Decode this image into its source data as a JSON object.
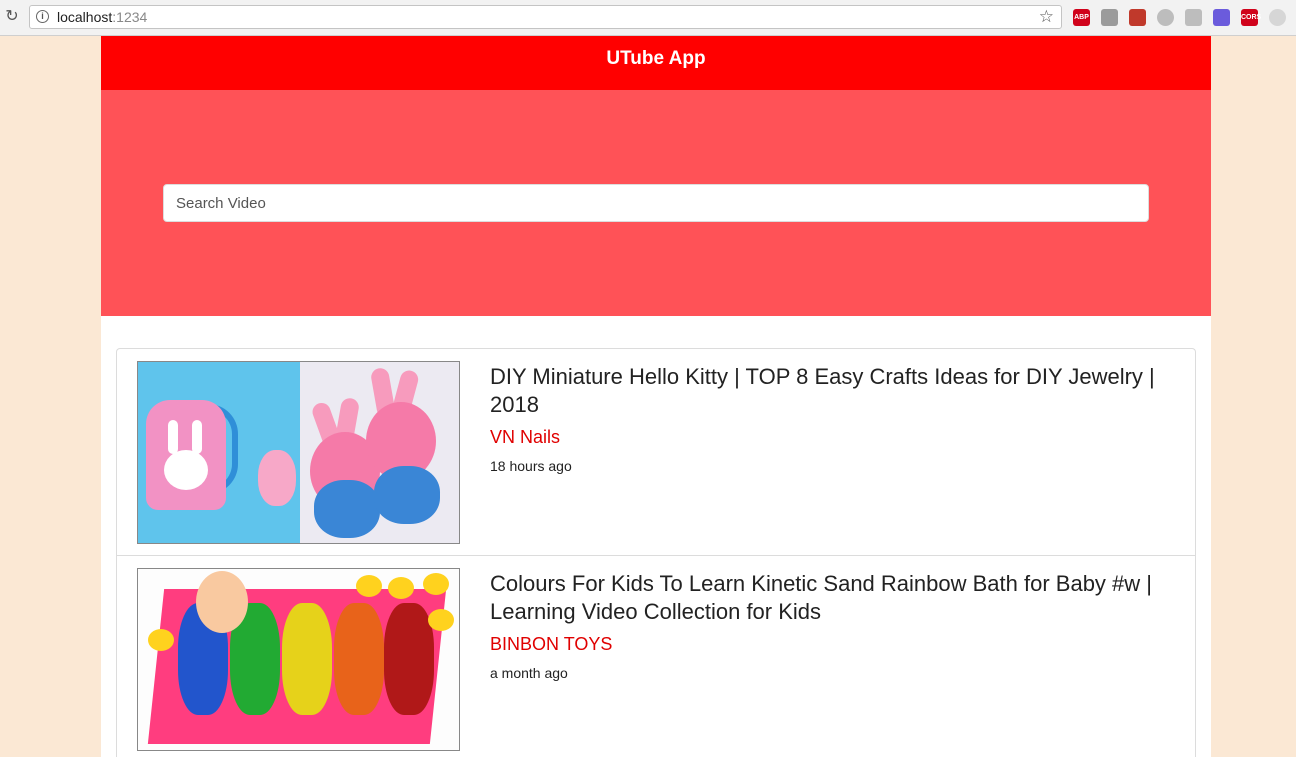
{
  "browser": {
    "url_host": "localhost",
    "url_port": ":1234",
    "extensions": [
      {
        "name": "adblock-plus-icon",
        "label": "ABP",
        "color": "#d0021b"
      },
      {
        "name": "vue-devtools-icon",
        "label": "",
        "color": "#9b9b9b"
      },
      {
        "name": "extension-red-icon",
        "label": "",
        "color": "#c0392b"
      },
      {
        "name": "extension-circle-icon",
        "label": "",
        "color": "#bdbdbd"
      },
      {
        "name": "extension-person-icon",
        "label": "",
        "color": "#bdbdbd"
      },
      {
        "name": "extension-gradient-icon",
        "label": "",
        "color": "#6b5bdc"
      },
      {
        "name": "cors-icon",
        "label": "CORS",
        "color": "#d0021b"
      },
      {
        "name": "extension-grey-icon",
        "label": "",
        "color": "#d6d6d6"
      }
    ]
  },
  "app": {
    "title": "UTube App",
    "search_placeholder": "Search Video"
  },
  "videos": [
    {
      "title": "DIY Miniature Hello Kitty | TOP 8 Easy Crafts Ideas for DIY Jewelry | 2018",
      "channel": "VN Nails",
      "time": "18 hours ago"
    },
    {
      "title": "Colours For Kids To Learn Kinetic Sand Rainbow Bath for Baby #w | Learning Video Collection for Kids",
      "channel": "BINBON TOYS",
      "time": "a month ago"
    }
  ],
  "colors": {
    "header": "#ff0000",
    "hero": "#ff5257",
    "channel": "#e00000",
    "page_bg": "#fbe8d4"
  }
}
